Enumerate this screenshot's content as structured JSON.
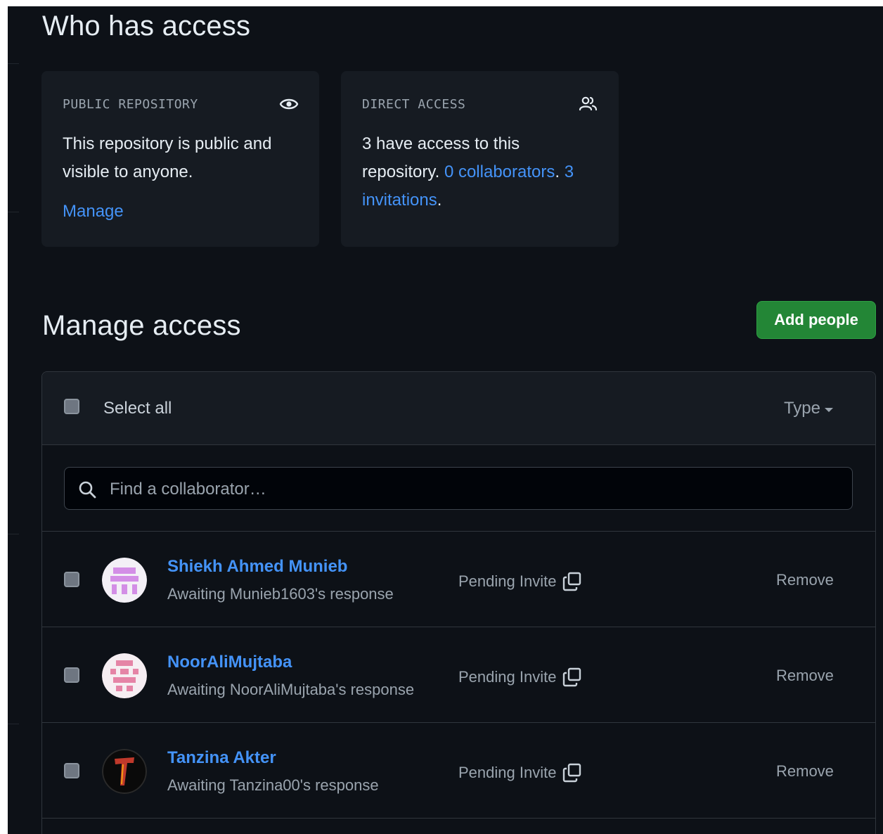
{
  "who_has_access": {
    "title": "Who has access",
    "public_card": {
      "label": "PUBLIC REPOSITORY",
      "icon": "eye-icon",
      "text": "This repository is public and visible to anyone.",
      "manage_link": "Manage"
    },
    "direct_card": {
      "label": "DIRECT ACCESS",
      "icon": "people-icon",
      "text_prefix": "3 have access to this repository.",
      "collaborators_link": "0 collaborators",
      "separator": ".",
      "invitations_link": "3 invitations",
      "suffix": "."
    }
  },
  "manage_access": {
    "title": "Manage access",
    "add_button": "Add people",
    "select_all": "Select all",
    "type_filter": "Type",
    "search_placeholder": "Find a collaborator…",
    "members": [
      {
        "name": "Shiekh Ahmed Munieb",
        "subtitle": "Awaiting Munieb1603's response",
        "status": "Pending Invite",
        "action": "Remove",
        "avatar_color": "#d38ee6"
      },
      {
        "name": "NoorAliMujtaba",
        "subtitle": "Awaiting NoorAliMujtaba's response",
        "status": "Pending Invite",
        "action": "Remove",
        "avatar_color": "#e584a6"
      },
      {
        "name": "Tanzina Akter",
        "subtitle": "Awaiting Tanzina00's response",
        "status": "Pending Invite",
        "action": "Remove",
        "avatar_color": "#c0392b"
      }
    ]
  },
  "colors": {
    "background": "#0d1117",
    "card": "#161b22",
    "link": "#4493f8",
    "primary_button": "#238636"
  }
}
